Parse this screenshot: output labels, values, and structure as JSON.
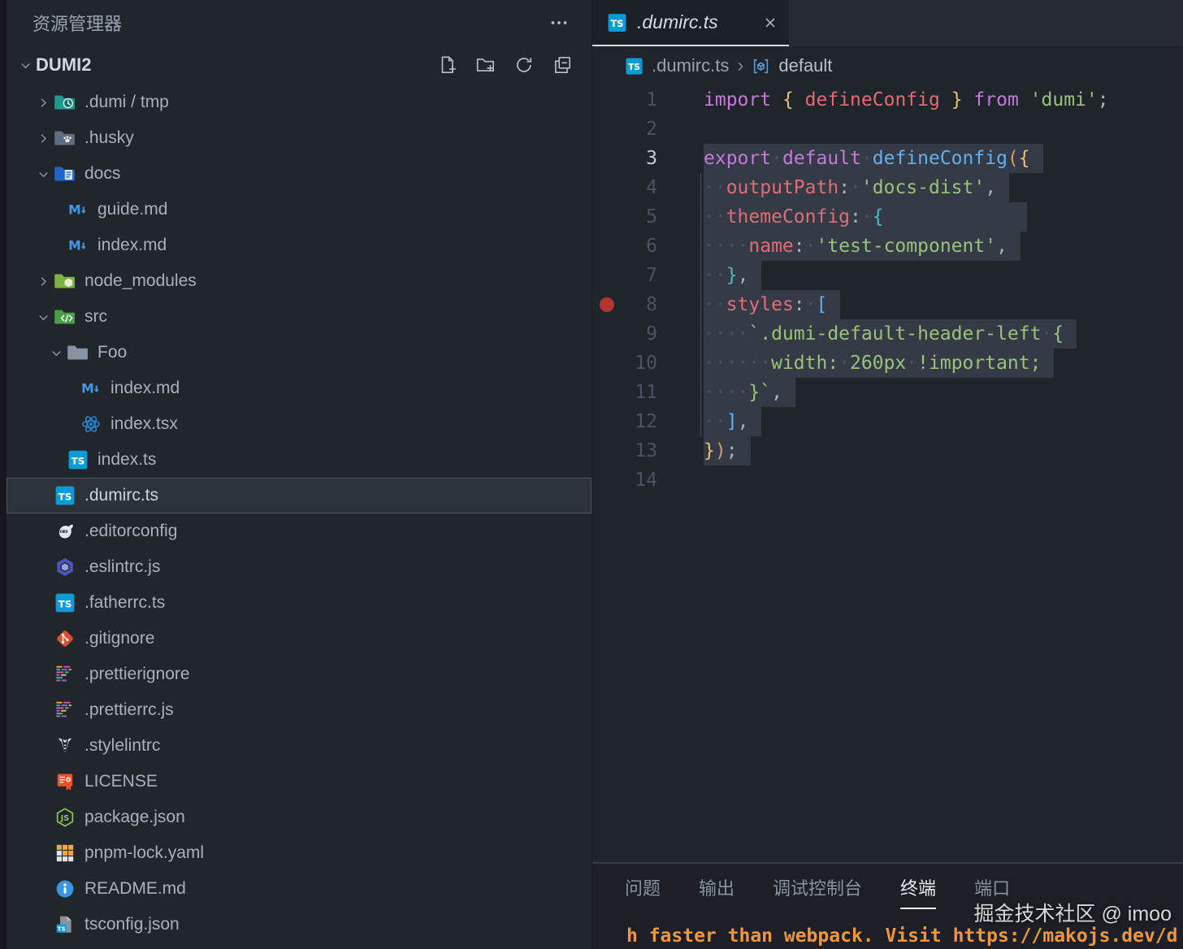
{
  "sidebar": {
    "title": "资源管理器",
    "project": "DUMI2",
    "actions": [
      "new-file",
      "new-folder",
      "refresh",
      "collapse-all"
    ],
    "tree": [
      {
        "label": ".dumi / tmp",
        "icon": "folder-temp",
        "depth": 0,
        "type": "folder",
        "expanded": false
      },
      {
        "label": ".husky",
        "icon": "folder-husky",
        "depth": 0,
        "type": "folder",
        "expanded": false
      },
      {
        "label": "docs",
        "icon": "folder-docs",
        "depth": 0,
        "type": "folder",
        "expanded": true
      },
      {
        "label": "guide.md",
        "icon": "markdown",
        "depth": 1,
        "type": "file"
      },
      {
        "label": "index.md",
        "icon": "markdown",
        "depth": 1,
        "type": "file"
      },
      {
        "label": "node_modules",
        "icon": "folder-node",
        "depth": 0,
        "type": "folder",
        "expanded": false
      },
      {
        "label": "src",
        "icon": "folder-src",
        "depth": 0,
        "type": "folder",
        "expanded": true
      },
      {
        "label": "Foo",
        "icon": "folder-plain",
        "depth": 1,
        "type": "folder",
        "expanded": true
      },
      {
        "label": "index.md",
        "icon": "markdown",
        "depth": 2,
        "type": "file"
      },
      {
        "label": "index.tsx",
        "icon": "react",
        "depth": 2,
        "type": "file"
      },
      {
        "label": "index.ts",
        "icon": "typescript",
        "depth": 1,
        "type": "file"
      },
      {
        "label": ".dumirc.ts",
        "icon": "typescript",
        "depth": 0,
        "type": "file",
        "selected": true
      },
      {
        "label": ".editorconfig",
        "icon": "editorconfig",
        "depth": 0,
        "type": "file"
      },
      {
        "label": ".eslintrc.js",
        "icon": "eslint",
        "depth": 0,
        "type": "file"
      },
      {
        "label": ".fatherrc.ts",
        "icon": "typescript",
        "depth": 0,
        "type": "file"
      },
      {
        "label": ".gitignore",
        "icon": "git",
        "depth": 0,
        "type": "file"
      },
      {
        "label": ".prettierignore",
        "icon": "prettier",
        "depth": 0,
        "type": "file"
      },
      {
        "label": ".prettierrc.js",
        "icon": "prettier",
        "depth": 0,
        "type": "file"
      },
      {
        "label": ".stylelintrc",
        "icon": "stylelint",
        "depth": 0,
        "type": "file"
      },
      {
        "label": "LICENSE",
        "icon": "license",
        "depth": 0,
        "type": "file"
      },
      {
        "label": "package.json",
        "icon": "nodejs",
        "depth": 0,
        "type": "file"
      },
      {
        "label": "pnpm-lock.yaml",
        "icon": "pnpm",
        "depth": 0,
        "type": "file"
      },
      {
        "label": "README.md",
        "icon": "readme",
        "depth": 0,
        "type": "file"
      },
      {
        "label": "tsconfig.json",
        "icon": "tsconfig",
        "depth": 0,
        "type": "file"
      }
    ]
  },
  "editor": {
    "tab": {
      "label": ".dumirc.ts",
      "icon": "typescript"
    },
    "breadcrumb": {
      "file": ".dumirc.ts",
      "sep": "›",
      "symbol": "default"
    },
    "lines": [
      {
        "n": 1,
        "seg": [
          [
            "p",
            "import"
          ],
          [
            "s",
            " "
          ],
          [
            "y",
            "{"
          ],
          [
            "s",
            " "
          ],
          [
            "r",
            "defineConfig"
          ],
          [
            "s",
            " "
          ],
          [
            "y",
            "}"
          ],
          [
            "s",
            " "
          ],
          [
            "p",
            "from"
          ],
          [
            "s",
            " "
          ],
          [
            "g",
            "'dumi'"
          ],
          [
            "w",
            ";"
          ]
        ]
      },
      {
        "n": 2,
        "seg": []
      },
      {
        "n": 3,
        "sel": true,
        "active": true,
        "seg": [
          [
            "p",
            "export"
          ],
          [
            "s",
            " "
          ],
          [
            "p",
            "default"
          ],
          [
            "s",
            " "
          ],
          [
            "b",
            "defineConfig"
          ],
          [
            "o",
            "("
          ],
          [
            "y",
            "{"
          ]
        ]
      },
      {
        "n": 4,
        "sel": true,
        "seg": [
          [
            "s",
            "  "
          ],
          [
            "r",
            "outputPath"
          ],
          [
            "w",
            ":"
          ],
          [
            "s",
            " "
          ],
          [
            "g",
            "'docs-dist'"
          ],
          [
            "w",
            ","
          ]
        ]
      },
      {
        "n": 5,
        "sel": true,
        "seg": [
          [
            "s",
            "  "
          ],
          [
            "r",
            "themeConfig"
          ],
          [
            "w",
            ":"
          ],
          [
            "s",
            " "
          ],
          [
            "c",
            "{"
          ],
          [
            "pad",
            "160"
          ]
        ]
      },
      {
        "n": 6,
        "sel": true,
        "seg": [
          [
            "s",
            "    "
          ],
          [
            "r",
            "name"
          ],
          [
            "w",
            ":"
          ],
          [
            "s",
            " "
          ],
          [
            "g",
            "'test-component'"
          ],
          [
            "w",
            ","
          ]
        ]
      },
      {
        "n": 7,
        "sel": true,
        "seg": [
          [
            "s",
            "  "
          ],
          [
            "c",
            "}"
          ],
          [
            "w",
            ","
          ]
        ]
      },
      {
        "n": 8,
        "sel": true,
        "bp": true,
        "seg": [
          [
            "s",
            "  "
          ],
          [
            "r",
            "styles"
          ],
          [
            "w",
            ":"
          ],
          [
            "s",
            " "
          ],
          [
            "b",
            "["
          ]
        ]
      },
      {
        "n": 9,
        "sel": true,
        "seg": [
          [
            "s",
            "    "
          ],
          [
            "g",
            "`.dumi-default-header-left"
          ],
          [
            "s",
            " "
          ],
          [
            "g",
            "{"
          ]
        ]
      },
      {
        "n": 10,
        "sel": true,
        "seg": [
          [
            "s",
            "      "
          ],
          [
            "g",
            "width:"
          ],
          [
            "s",
            " "
          ],
          [
            "g",
            "260px"
          ],
          [
            "s",
            " "
          ],
          [
            "g",
            "!important;"
          ]
        ]
      },
      {
        "n": 11,
        "sel": true,
        "seg": [
          [
            "s",
            "    "
          ],
          [
            "g",
            "}`"
          ],
          [
            "w",
            ","
          ]
        ]
      },
      {
        "n": 12,
        "sel": true,
        "seg": [
          [
            "s",
            "  "
          ],
          [
            "b",
            "]"
          ],
          [
            "w",
            ","
          ]
        ]
      },
      {
        "n": 13,
        "sel": true,
        "seg": [
          [
            "y",
            "}"
          ],
          [
            "o",
            ")"
          ],
          [
            "w",
            ";"
          ]
        ]
      },
      {
        "n": 14,
        "seg": []
      }
    ]
  },
  "panel": {
    "tabs": [
      {
        "label": "问题"
      },
      {
        "label": "输出"
      },
      {
        "label": "调试控制台"
      },
      {
        "label": "终端",
        "active": true
      },
      {
        "label": "端口"
      }
    ],
    "terminal_text": "h faster than webpack. Visit https://makojs.dev/d"
  },
  "watermark": "掘金技术社区 @ imoo",
  "colors": {
    "purple": "#c678dd",
    "red": "#e06c75",
    "green": "#98c379",
    "blue": "#61afef",
    "cyan": "#56b6c2",
    "gold": "#e5c07b",
    "orange": "#d19a66",
    "fg": "#abb2bf",
    "whitespace": "#4a5160",
    "selection": "#343b47",
    "breakpoint": "#b0342f",
    "terminal": "#f0963c",
    "editor_bg": "#20242b",
    "sidebar_bg": "#21262d"
  }
}
